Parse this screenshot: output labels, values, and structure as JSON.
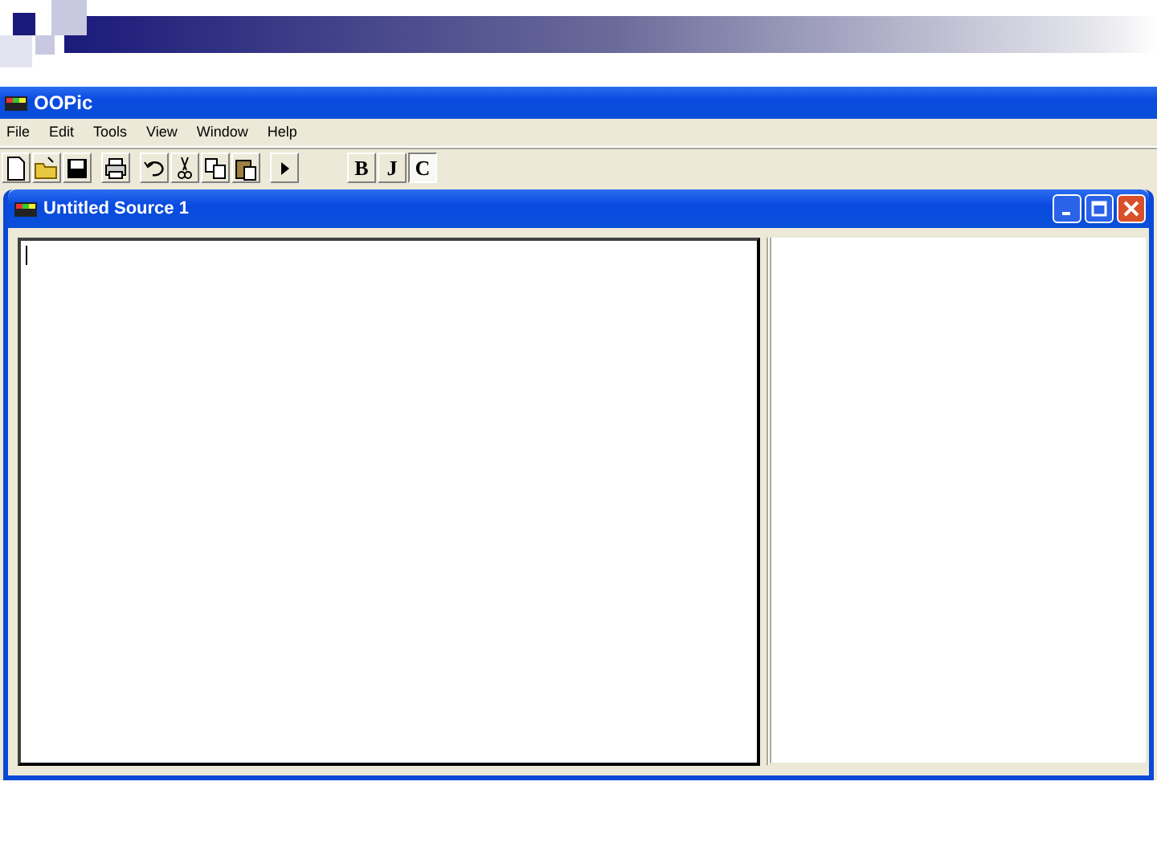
{
  "app_window": {
    "title": "OOPic"
  },
  "menu": [
    {
      "label": "File"
    },
    {
      "label": "Edit"
    },
    {
      "label": "Tools"
    },
    {
      "label": "View"
    },
    {
      "label": "Window"
    },
    {
      "label": "Help"
    }
  ],
  "format_buttons": [
    {
      "label": "B",
      "pressed": false
    },
    {
      "label": "J",
      "pressed": false
    },
    {
      "label": "C",
      "pressed": true
    }
  ],
  "document_window": {
    "title": "Untitled Source 1"
  }
}
